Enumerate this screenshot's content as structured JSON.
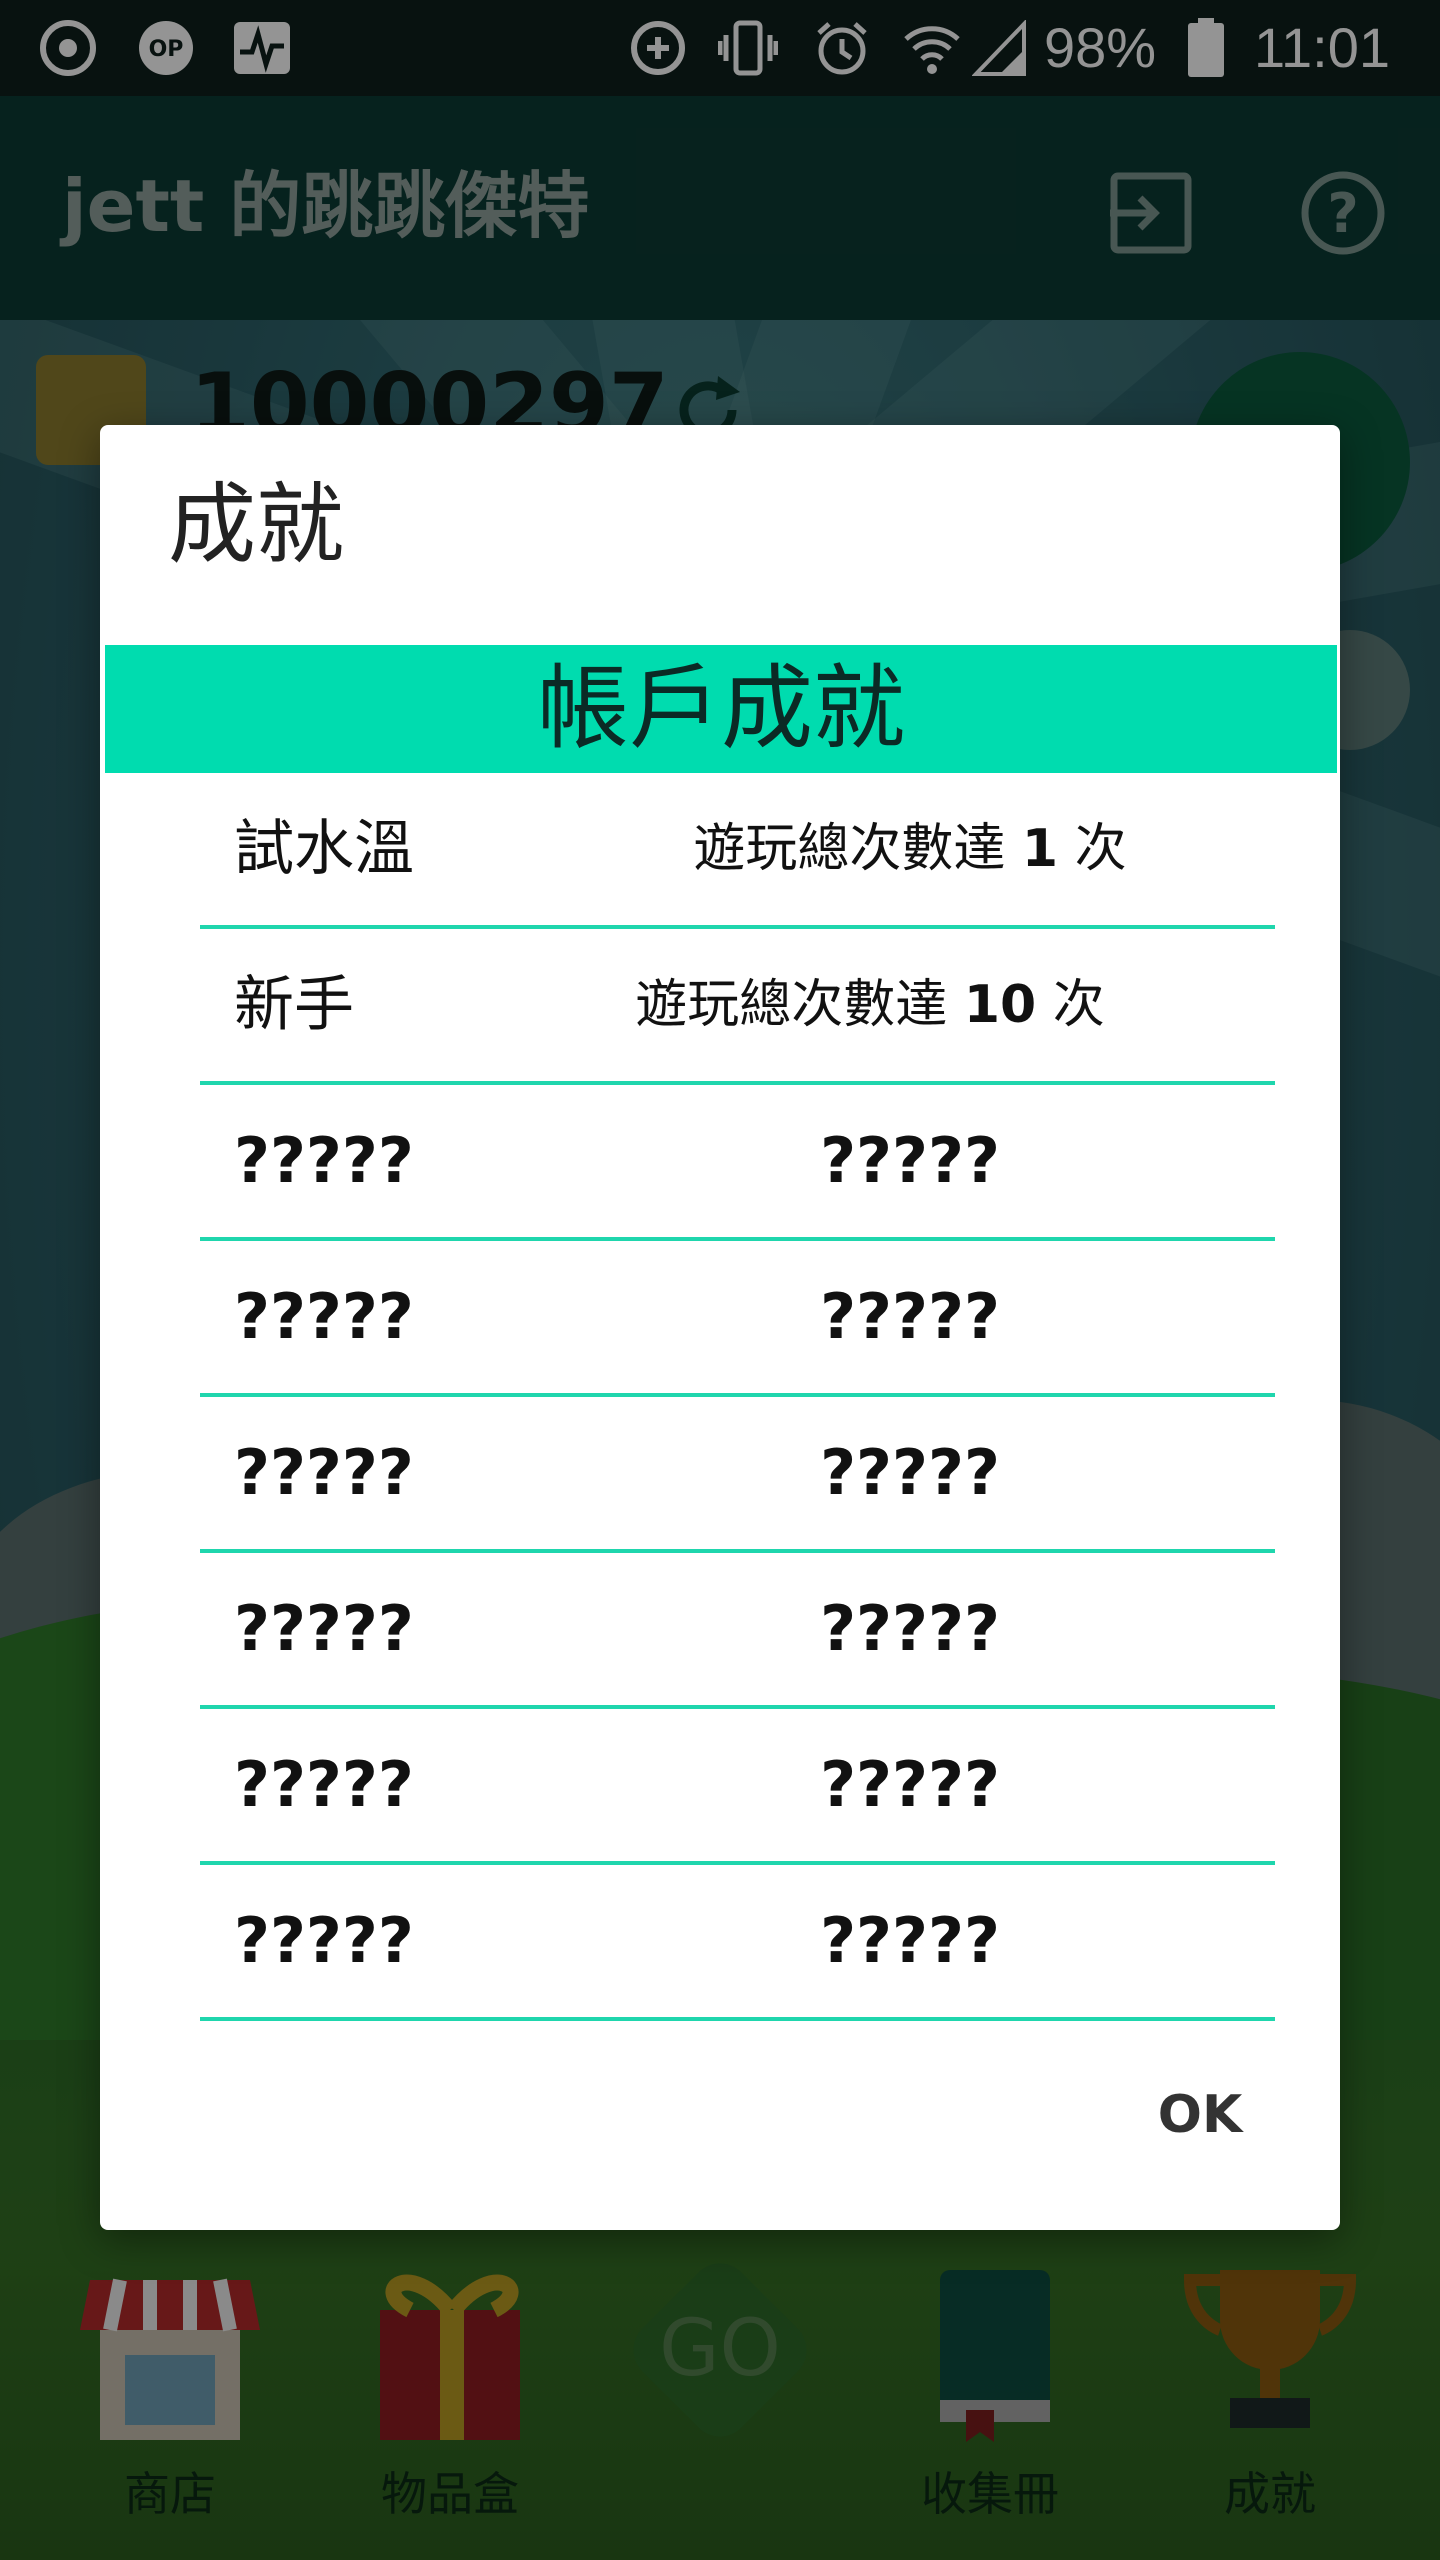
{
  "status_bar": {
    "battery": "98%",
    "time": "11:01",
    "icons": [
      "chrome-icon",
      "op-icon",
      "activity-icon",
      "data-saver-icon",
      "vibrate-icon",
      "alarm-icon",
      "wifi-icon",
      "signal-icon",
      "battery-icon"
    ]
  },
  "app_bar": {
    "title": "jett 的跳跳傑特",
    "icons": [
      "exit-icon",
      "help-icon"
    ]
  },
  "background": {
    "coins": "10000297"
  },
  "bottom_nav": {
    "items": [
      {
        "label": "商店",
        "icon": "shop-icon"
      },
      {
        "label": "物品盒",
        "icon": "gift-box-icon"
      },
      {
        "label": "GO",
        "icon": "go-icon"
      },
      {
        "label": "收集冊",
        "icon": "book-icon"
      },
      {
        "label": "成就",
        "icon": "trophy-icon"
      }
    ]
  },
  "dialog": {
    "title": "成就",
    "section_header": "帳戶成就",
    "rows": [
      {
        "name": "試水溫",
        "desc_pre": "遊玩總次數達",
        "desc_num": "1",
        "desc_post": "次"
      },
      {
        "name": "新手",
        "desc_pre": "遊玩總次數達",
        "desc_num": "10",
        "desc_post": "次"
      },
      {
        "name": "?????",
        "desc": "?????"
      },
      {
        "name": "?????",
        "desc": "?????"
      },
      {
        "name": "?????",
        "desc": "?????"
      },
      {
        "name": "?????",
        "desc": "?????"
      },
      {
        "name": "?????",
        "desc": "?????"
      },
      {
        "name": "?????",
        "desc": "?????"
      }
    ],
    "ok_label": "OK"
  },
  "colors": {
    "accent": "#00dcaf",
    "divider": "#1fd6ad",
    "appbar": "#0c3b34"
  }
}
